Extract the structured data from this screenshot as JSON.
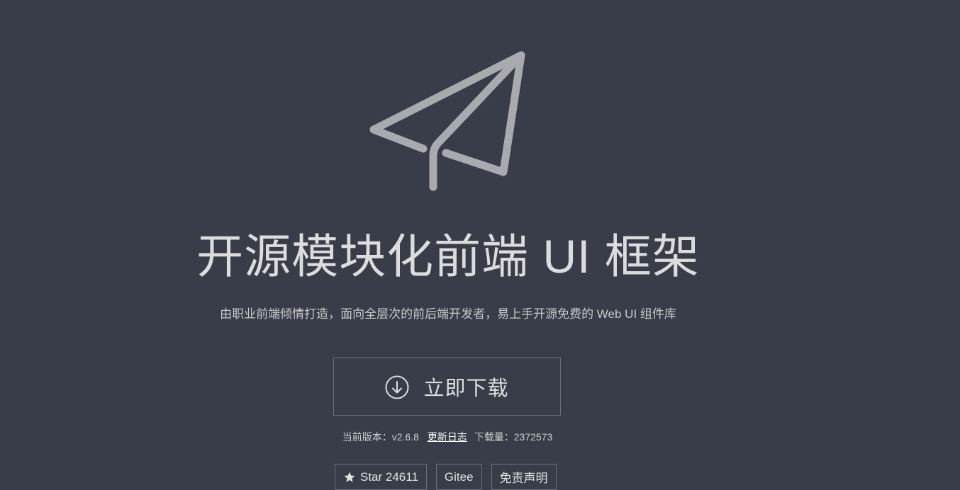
{
  "hero": {
    "title": "开源模块化前端 UI 框架",
    "subtitle": "由职业前端倾情打造，面向全层次的前后端开发者，易上手开源免费的 Web UI 组件库",
    "logo_icon": "paper-plane-icon"
  },
  "download": {
    "label": "立即下载",
    "icon": "download-circle-icon"
  },
  "meta": {
    "version_label": "当前版本：",
    "version": "v2.6.8",
    "changelog": "更新日志",
    "downloads_label": "下载量：",
    "downloads": "2372573"
  },
  "badges": {
    "star_label": "Star 24611",
    "gitee_label": "Gitee",
    "disclaimer_label": "免责声明"
  },
  "colors": {
    "background": "#393d49",
    "logo": "#a9aab0",
    "border": "#6b6f7a"
  }
}
